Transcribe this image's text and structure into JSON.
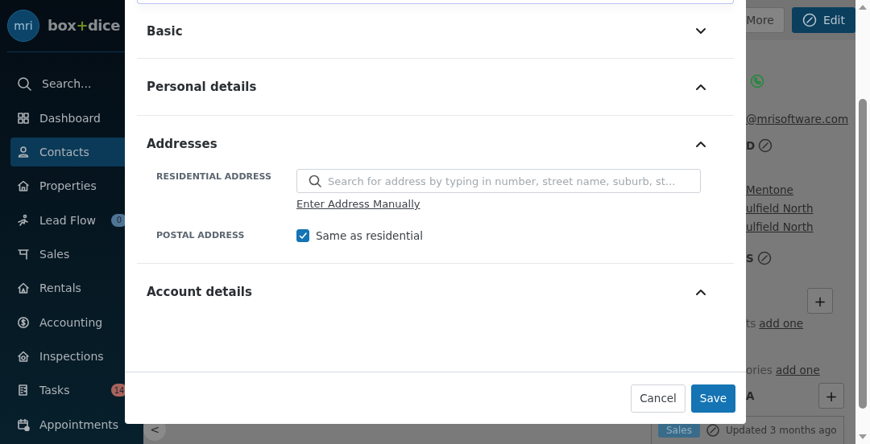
{
  "sidebar": {
    "logo": {
      "mark": "mri",
      "brand": [
        "box",
        "+",
        "dice"
      ]
    },
    "search": {
      "label": "Search..."
    },
    "items": [
      {
        "label": "Dashboard",
        "selected": false
      },
      {
        "label": "Contacts",
        "selected": true
      },
      {
        "label": "Properties",
        "selected": false
      },
      {
        "label": "Lead Flow",
        "selected": false,
        "badge": "0",
        "color": "#4f7596"
      },
      {
        "label": "Sales",
        "selected": false
      },
      {
        "label": "Rentals",
        "selected": false
      },
      {
        "label": "Accounting",
        "selected": false
      },
      {
        "label": "Inspections",
        "selected": false
      },
      {
        "label": "Tasks",
        "selected": false,
        "badge": "14",
        "color": "#a8645c"
      },
      {
        "label": "Appointments",
        "selected": false
      }
    ]
  },
  "background": {
    "toolbar": [
      {
        "label": "More",
        "kind": "plain"
      },
      {
        "label": "Edit",
        "kind": "primary"
      }
    ],
    "rows": [
      {
        "kind": "phone"
      },
      {
        "kind": "link",
        "text": "@mrisoftware.com"
      },
      {
        "kind": "heading",
        "text": "D"
      },
      {
        "kind": "link",
        "text": "Mentone"
      },
      {
        "kind": "link",
        "text": "ulfield North"
      },
      {
        "kind": "link",
        "text": "ulfield North"
      },
      {
        "kind": "heading",
        "text": "S"
      },
      {
        "kind": "plus",
        "button": "+"
      },
      {
        "kind": "add",
        "text": "ts",
        "link": "add one"
      },
      {
        "kind": "add",
        "text": "ories",
        "link": "add one"
      },
      {
        "kind": "heading-plus",
        "text": "A",
        "button": "+"
      }
    ],
    "footer": {
      "collapse": "<",
      "tag": "Sales",
      "updated": "Updated 3 months ago"
    }
  },
  "modal": {
    "sections": [
      {
        "title": "Basic",
        "expanded": false
      },
      {
        "title": "Personal details",
        "expanded": true
      },
      {
        "title": "Addresses",
        "expanded": true,
        "fields": [
          {
            "kind": "search",
            "label": "RESIDENTIAL ADDRESS",
            "placeholder": "Search for address by typing in number, street name, suburb, st...",
            "link": "Enter Address Manually"
          },
          {
            "kind": "checkbox",
            "label": "POSTAL ADDRESS",
            "option": "Same as residential",
            "checked": true
          }
        ]
      },
      {
        "title": "Account details",
        "expanded": true
      }
    ],
    "buttons": [
      {
        "label": "Cancel",
        "kind": "secondary"
      },
      {
        "label": "Save",
        "kind": "primary"
      }
    ]
  }
}
